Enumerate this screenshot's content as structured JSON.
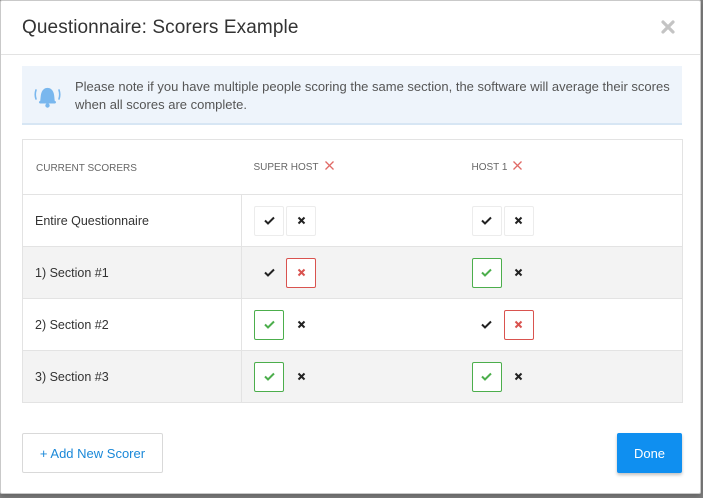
{
  "modal": {
    "title": "Questionnaire: Scorers Example",
    "close_icon": "close-icon"
  },
  "notice": {
    "icon": "bell-icon",
    "text": "Please note if you have multiple people scoring the same section, the software will average their scores when all scores are complete."
  },
  "table": {
    "header_label": "CURRENT SCORERS",
    "scorers": [
      {
        "name": "SUPER HOST",
        "remove_icon": "remove-scorer-icon"
      },
      {
        "name": "HOST 1",
        "remove_icon": "remove-scorer-icon"
      }
    ],
    "rows": [
      {
        "label": "Entire Questionnaire",
        "assignments": [
          "none",
          "none"
        ]
      },
      {
        "label": "1) Section #1",
        "assignments": [
          "no",
          "yes"
        ]
      },
      {
        "label": "2) Section #2",
        "assignments": [
          "yes",
          "no"
        ]
      },
      {
        "label": "3) Section #3",
        "assignments": [
          "yes",
          "yes"
        ]
      }
    ]
  },
  "footer": {
    "add_scorer_label": "+ Add New Scorer",
    "done_label": "Done"
  },
  "colors": {
    "accent": "#0f8ff0",
    "yes": "#4cae4c",
    "no": "#d9534f",
    "notice_bg": "#eef4fb"
  }
}
